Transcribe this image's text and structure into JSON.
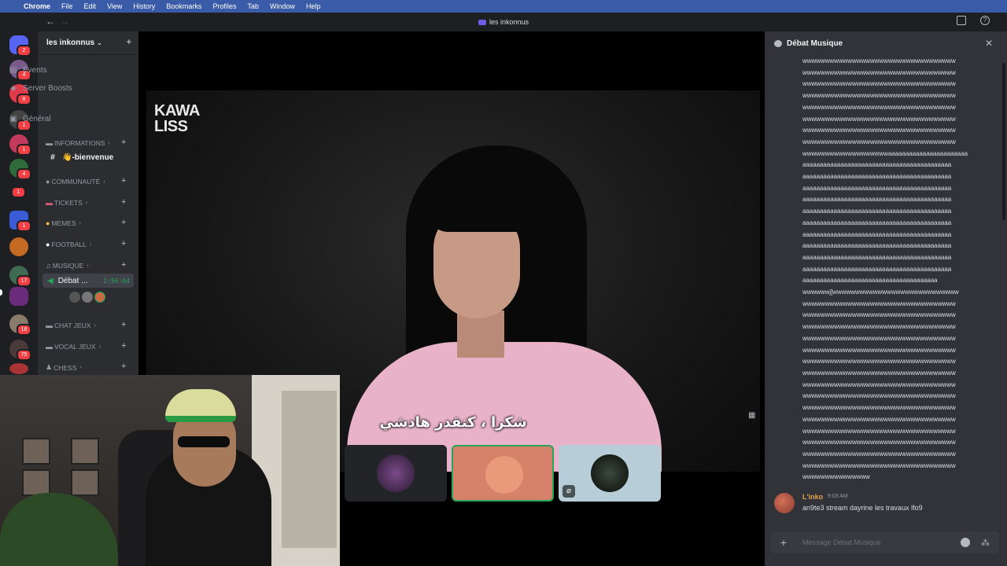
{
  "menubar": {
    "items": [
      "Chrome",
      "File",
      "Edit",
      "View",
      "History",
      "Bookmarks",
      "Profiles",
      "Tab",
      "Window",
      "Help"
    ]
  },
  "window": {
    "title": "les inkonnus"
  },
  "server": {
    "name": "les inkonnus"
  },
  "rail_badges": [
    "2",
    "4",
    "8",
    "1",
    "1",
    "4",
    "1",
    "1",
    "17",
    "16",
    "75"
  ],
  "sidebar": {
    "events": "Events",
    "boosts": "Server Boosts",
    "general": "Général",
    "cat_informations": "INFORMATIONS",
    "bienvenue": "👋-bienvenue",
    "cat_communaute": "COMMUNAUTÉ",
    "cat_tickets": "TICKETS",
    "cat_memes": "MEMES",
    "cat_football": "FOOTBALL",
    "cat_musique": "MUSIQUE",
    "voice_active": "Débat ...",
    "voice_timer": "2:56:04",
    "cat_chat_jeux": "CHAT JEUX",
    "cat_vocal_jeux": "VOCAL JEUX",
    "cat_chess": "CHESS"
  },
  "stream": {
    "logo_line1": "KAWA",
    "logo_line2": "LISS",
    "subtitle": "شكرا ، كنقدر هادشي"
  },
  "chat": {
    "title": "Débat Musique",
    "spam_lines": [
      "wwwwwwwwwwwwwwwwwwwwwwwwwwwwwwwwww",
      "wwwwwwwwwwwwwwwwwwwwwwwwwwwwwwwwww",
      "wwwwwwwwwwwwwwwwwwwwwwwwwwwwwwwwww",
      "wwwwwwwwwwwwwwwwwwwwwwwwwwwwwwwwww",
      "wwwwwwwwwwwwwwwwwwwwwwwwwwwwwwwwww",
      "wwwwwwwwwwwwwwwwwwwwwwwwwwwwwwwwww",
      "wwwwwwwwwwwwwwwwwwwwwwwwwwwwwwwwww",
      "wwwwwwwwwwwwwwwwwwwwwwwwwwwwwwwwww",
      "wwwwwwwwwwwwwwwwwwwaaaaaaaaaaaaaaaaaaaaaaa",
      "aaaaaaaaaaaaaaaaaaaaaaaaaaaaaaaaaaaaaaaaaaa",
      "aaaaaaaaaaaaaaaaaaaaaaaaaaaaaaaaaaaaaaaaaaa",
      "aaaaaaaaaaaaaaaaaaaaaaaaaaaaaaaaaaaaaaaaaaa",
      "aaaaaaaaaaaaaaaaaaaaaaaaaaaaaaaaaaaaaaaaaaa",
      "aaaaaaaaaaaaaaaaaaaaaaaaaaaaaaaaaaaaaaaaaaa",
      "aaaaaaaaaaaaaaaaaaaaaaaaaaaaaaaaaaaaaaaaaaa",
      "aaaaaaaaaaaaaaaaaaaaaaaaaaaaaaaaaaaaaaaaaaa",
      "aaaaaaaaaaaaaaaaaaaaaaaaaaaaaaaaaaaaaaaaaaa",
      "aaaaaaaaaaaaaaaaaaaaaaaaaaaaaaaaaaaaaaaaaaa",
      "aaaaaaaaaaaaaaaaaaaaaaaaaaaaaaaaaaaaaaaaaaa",
      "aaaaaaaaaaaaaaaaaaaaaaaaaaaaaaaaaaaaaaa",
      "wwwwwwj]wwwwwwwwwwwwwwwwwwwwwwwwwwww",
      "wwwwwwwwwwwwwwwwwwwwwwwwwwwwwwwwww",
      "wwwwwwwwwwwwwwwwwwwwwwwwwwwwwwwwww",
      "wwwwwwwwwwwwwwwwwwwwwwwwwwwwwwwwww",
      "wwwwwwwwwwwwwwwwwwwwwwwwwwwwwwwwww",
      "wwwwwwwwwwwwwwwwwwwwwwwwwwwwwwwwww",
      "wwwwwwwwwwwwwwwwwwwwwwwwwwwwwwwwww",
      "wwwwwwwwwwwwwwwwwwwwwwwwwwwwwwwwww",
      "wwwwwwwwwwwwwwwwwwwwwwwwwwwwwwwwww",
      "wwwwwwwwwwwwwwwwwwwwwwwwwwwwwwwwww",
      "wwwwwwwwwwwwwwwwwwwwwwwwwwwwwwwwww",
      "wwwwwwwwwwwwwwwwwwwwwwwwwwwwwwwwww",
      "wwwwwwwwwwwwwwwwwwwwwwwwwwwwwwwwww",
      "wwwwwwwwwwwwwwwwwwwwwwwwwwwwwwwwww",
      "wwwwwwwwwwwwwwwwwwwwwwwwwwwwwwwwww",
      "wwwwwwwwwwwwwwwwwwwwwwwwwwwwwwwwww",
      "wwwwwwwwwwwwwww"
    ],
    "message": {
      "author": "L'inko",
      "time": "9:03 AM",
      "text": "an9te3 stream dayrine les travaux lfo9"
    },
    "composer_placeholder": "Message Débat Musique"
  },
  "colors": {
    "accent_voice": "#23a55a",
    "badge": "#f23f43",
    "author": "#e0a34c"
  }
}
